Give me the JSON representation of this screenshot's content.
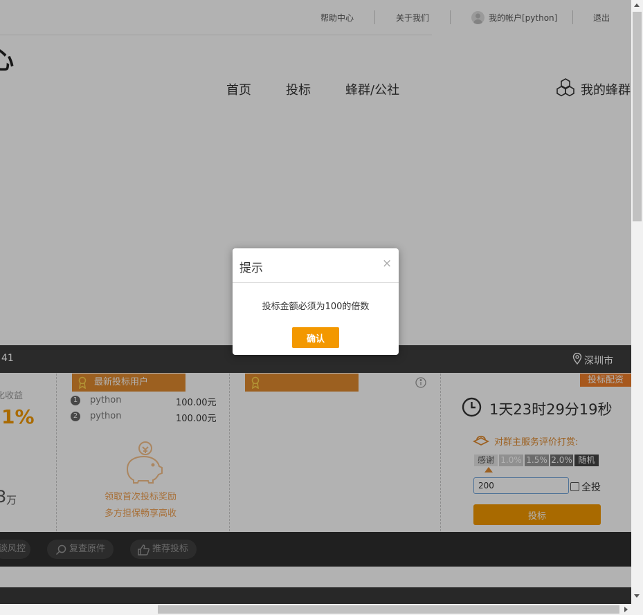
{
  "topbar": {
    "help": "帮助中心",
    "about": "关于我们",
    "account": "我的帐户[python]",
    "logout": "退出"
  },
  "logo": {
    "partial": "心"
  },
  "nav": {
    "home": "首页",
    "bid": "投标",
    "swarm": "蜂群/公社",
    "my_swarm": "我的蜂群"
  },
  "info_bar": {
    "left_text": "41",
    "location": "深圳市"
  },
  "col1": {
    "yield_label": "化收益",
    "yield_value": "1%",
    "amount_unit": "万",
    "amount_partial": "3"
  },
  "latest": {
    "title": "最新投标用户",
    "rows": [
      {
        "num": "1",
        "user": "python",
        "amount": "100.00元"
      },
      {
        "num": "2",
        "user": "python",
        "amount": "100.00元"
      }
    ],
    "promo_line1": "领取首次投标奖励",
    "promo_line2": "多方担保畅享高收"
  },
  "bid_panel": {
    "tag": "投标配资",
    "countdown": "1天23时29分19秒",
    "rating_label": "对群主服务评价打赏:",
    "rates": [
      "感谢",
      "1.0%",
      "1.5%",
      "2.0%",
      "随机"
    ],
    "amount_value": "200",
    "all_in_label": "全投",
    "submit_label": "投标"
  },
  "toolbar": {
    "risk": "谈风控",
    "review": "复查原件",
    "recommend": "推荐投标"
  },
  "modal": {
    "title": "提示",
    "message": "投标金额必须为100的倍数",
    "confirm": "确认",
    "close": "×"
  },
  "colors": {
    "accent": "#f39800",
    "dark_bar": "#3d3d3d",
    "ribbon": "#e08a2e"
  }
}
